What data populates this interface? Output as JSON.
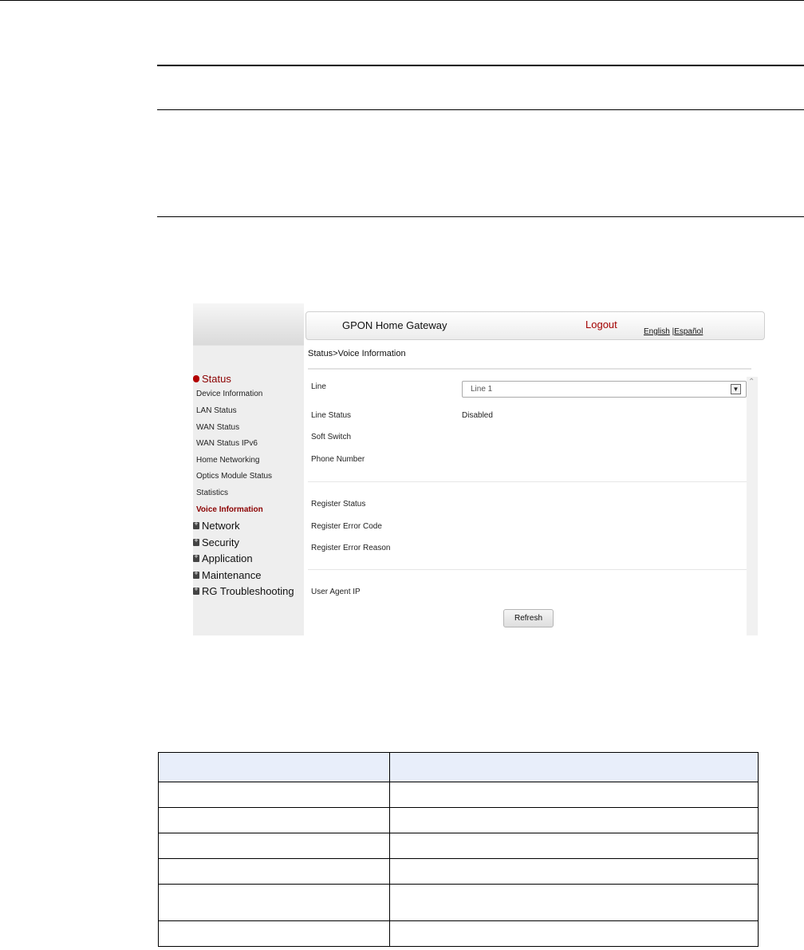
{
  "gateway": {
    "brand": "GPON Home Gateway",
    "logout": "Logout",
    "lang_english": "English",
    "lang_sep": "|",
    "lang_spanish": "Español",
    "breadcrumb": "Status>Voice Information"
  },
  "nav": {
    "status": "Status",
    "status_items": [
      "Device Information",
      "LAN Status",
      "WAN Status",
      "WAN Status IPv6",
      "Home Networking",
      "Optics Module Status",
      "Statistics",
      "Voice Information"
    ],
    "network": "Network",
    "security": "Security",
    "application": "Application",
    "maintenance": "Maintenance",
    "rg_troubleshooting": "RG Troubleshooting"
  },
  "form": {
    "line_label": "Line",
    "line_value": "Line 1",
    "line_status_label": "Line Status",
    "line_status_value": "Disabled",
    "soft_switch_label": "Soft Switch",
    "phone_number_label": "Phone Number",
    "register_status_label": "Register Status",
    "register_error_code_label": "Register Error Code",
    "register_error_reason_label": "Register Error Reason",
    "user_agent_ip_label": "User Agent IP",
    "refresh_label": "Refresh"
  },
  "colors": {
    "accent": "#a30000",
    "table_header": "#e8eefa"
  }
}
